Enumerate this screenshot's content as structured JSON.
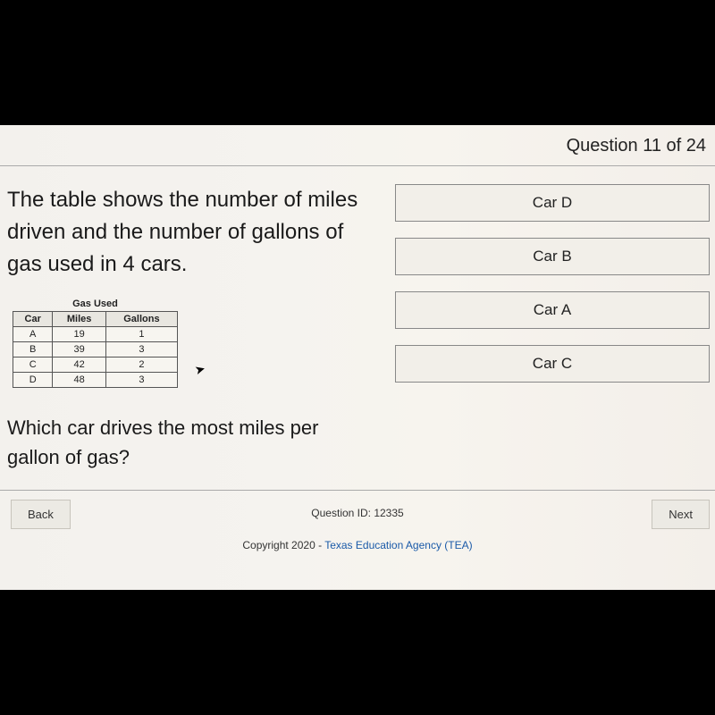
{
  "header": {
    "counter": "Question 11 of 24"
  },
  "question": {
    "prompt_intro": "The table shows the number of miles driven and the number of gallons of gas used in 4 cars.",
    "prompt_ask": "Which car drives the most miles per gallon of gas?"
  },
  "table": {
    "title": "Gas Used",
    "headers": [
      "Car",
      "Miles",
      "Gallons"
    ],
    "rows": [
      {
        "car": "A",
        "miles": "19",
        "gallons": "1"
      },
      {
        "car": "B",
        "miles": "39",
        "gallons": "3"
      },
      {
        "car": "C",
        "miles": "42",
        "gallons": "2"
      },
      {
        "car": "D",
        "miles": "48",
        "gallons": "3"
      }
    ]
  },
  "answers": [
    {
      "label": "Car D"
    },
    {
      "label": "Car B"
    },
    {
      "label": "Car A"
    },
    {
      "label": "Car C"
    }
  ],
  "footer": {
    "question_id": "Question ID: 12335",
    "back": "Back",
    "next": "Next",
    "copyright_prefix": "Copyright 2020 - ",
    "copyright_link": "Texas Education Agency (TEA)"
  }
}
